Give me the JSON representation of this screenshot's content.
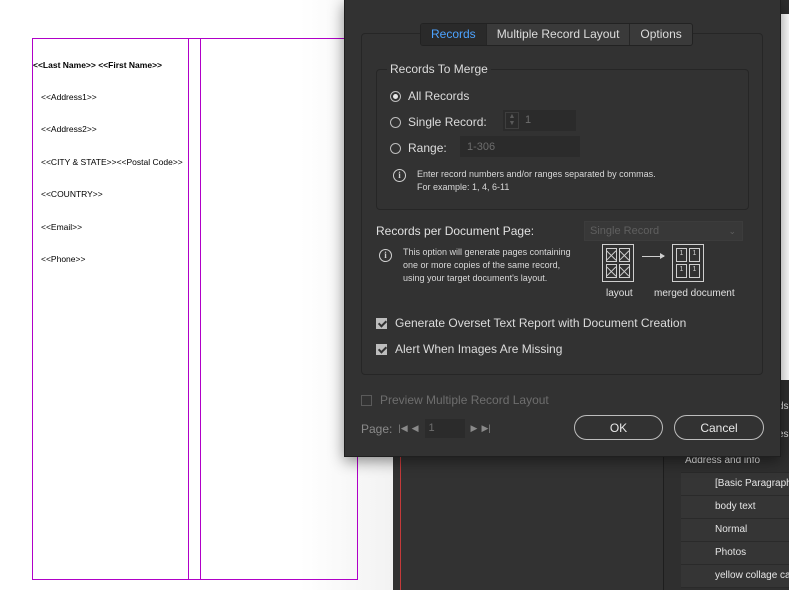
{
  "document": {
    "merge_lines": [
      {
        "parts": [
          {
            "text": "<<Last Name>> <<First Name>>",
            "bold": true
          }
        ]
      },
      {
        "text": "<<Address1>>"
      },
      {
        "text": "<<Address2>>"
      },
      {
        "text": "<<CITY & STATE>><<Postal Code>>"
      },
      {
        "text": "<<COUNTRY>>"
      },
      {
        "text": "<<Email>>"
      },
      {
        "text": "<<Phone>>"
      }
    ]
  },
  "dialog": {
    "tabs": [
      "Records",
      "Multiple Record Layout",
      "Options"
    ],
    "active_tab": "Records",
    "records_to_merge": {
      "label": "Records To Merge",
      "all_records": "All Records",
      "single_record": "Single Record:",
      "single_record_value": "1",
      "range": "Range:",
      "range_value": "1-306",
      "selected": "All Records",
      "hint": "Enter record numbers and/or ranges separated by commas. For example: 1, 4, 6-11"
    },
    "records_per_page": {
      "label": "Records per Document Page:",
      "select_value": "Single Record",
      "info": "This option will generate pages containing one or more copies of the same record, using your target document's layout.",
      "diagram_layout_label": "layout",
      "diagram_merged_label": "merged document",
      "diagram_cell_text": "1"
    },
    "checkboxes": {
      "overset": {
        "label": "Generate Overset Text Report with Document Creation",
        "checked": true
      },
      "images": {
        "label": "Alert When Images Are Missing",
        "checked": true
      },
      "preview": {
        "label": "Preview Multiple Record Layout",
        "checked": false
      }
    },
    "page_nav": {
      "label": "Page:",
      "value": "1"
    },
    "ok_label": "OK",
    "cancel_label": "Cancel"
  },
  "side_panel": {
    "fragments": [
      "ds",
      "es"
    ],
    "group_label": "Address and info",
    "items": [
      "[Basic Paragraph]",
      "body text",
      "Normal",
      "Photos",
      "yellow collage caption"
    ]
  },
  "colors": {
    "dialog_bg": "#323232",
    "accent": "#4da3ff",
    "frame": "#b000c8"
  }
}
